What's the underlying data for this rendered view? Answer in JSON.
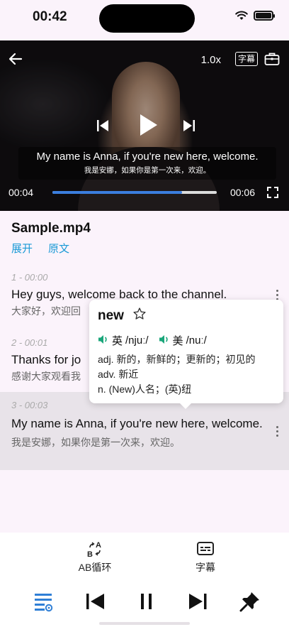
{
  "status_bar": {
    "time": "00:42"
  },
  "video": {
    "speed": "1.0x",
    "subtitle_button": "字幕",
    "current_time": "00:04",
    "duration": "00:06",
    "progress": 0.79,
    "overlay_en": "My name is Anna, if you're new here, welcome.",
    "overlay_zh": "我是安娜，如果你是第一次来，欢迎。"
  },
  "file": {
    "title": "Sample.mp4",
    "expand_label": "展开",
    "original_label": "原文"
  },
  "cues": [
    {
      "meta": "1 - 00:00",
      "en": "Hey guys, welcome back to the channel.",
      "zh": "大家好，欢迎回"
    },
    {
      "meta": "2 - 00:01",
      "en": "Thanks for jo",
      "zh": "感谢大家观看我"
    },
    {
      "meta": "3 - 00:03",
      "en": "My name is Anna, if you're new here, welcome.",
      "zh": "我是安娜，如果你是第一次来，欢迎。"
    }
  ],
  "popup": {
    "word": "new",
    "uk_label": "英",
    "uk_phonetic": "/njuː/",
    "us_label": "美",
    "us_phonetic": "/nuː/",
    "def1": "adj. 新的，新鲜的；更新的；初见的",
    "def2": "adv. 新近",
    "def3": "n. (New)人名；(英)纽"
  },
  "tools": {
    "ab_loop": "AB循环",
    "subtitle": "字幕"
  },
  "colors": {
    "accent": "#1a9ad6",
    "progress": "#3b7ede",
    "speaker": "#1aa67a"
  }
}
